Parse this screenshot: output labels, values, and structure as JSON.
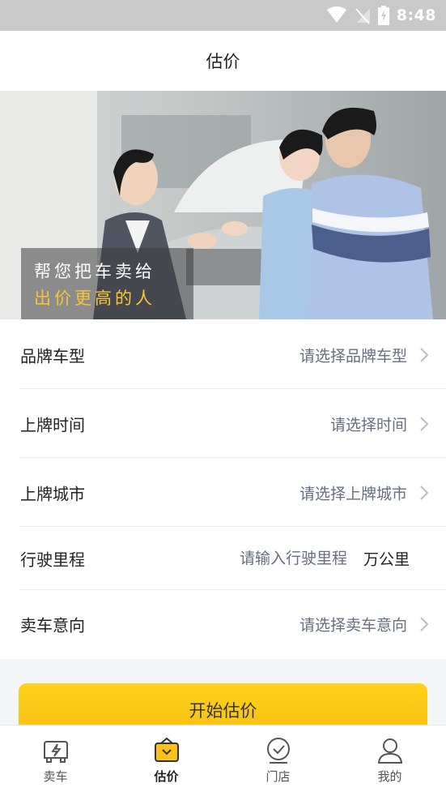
{
  "status_bar": {
    "time": "8:48"
  },
  "header": {
    "title": "估价"
  },
  "banner": {
    "line1": "帮您把车卖给",
    "line2": "出价更高的人"
  },
  "form": {
    "brand_model": {
      "label": "品牌车型",
      "placeholder": "请选择品牌车型"
    },
    "plate_date": {
      "label": "上牌时间",
      "placeholder": "请选择时间"
    },
    "plate_city": {
      "label": "上牌城市",
      "placeholder": "请选择上牌城市"
    },
    "mileage": {
      "label": "行驶里程",
      "placeholder": "请输入行驶里程",
      "unit": "万公里"
    },
    "intent": {
      "label": "卖车意向",
      "placeholder": "请选择卖车意向"
    }
  },
  "start_button": {
    "label": "开始估价"
  },
  "tabbar": {
    "tabs": [
      {
        "label": "卖车",
        "icon": "sell-car-icon",
        "active": false
      },
      {
        "label": "估价",
        "icon": "valuation-icon",
        "active": true
      },
      {
        "label": "门店",
        "icon": "store-location-icon",
        "active": false
      },
      {
        "label": "我的",
        "icon": "profile-icon",
        "active": false
      }
    ]
  },
  "colors": {
    "accent": "#f9c21a",
    "placeholder_text": "#666e80",
    "caption_highlight": "#f8c43a"
  }
}
